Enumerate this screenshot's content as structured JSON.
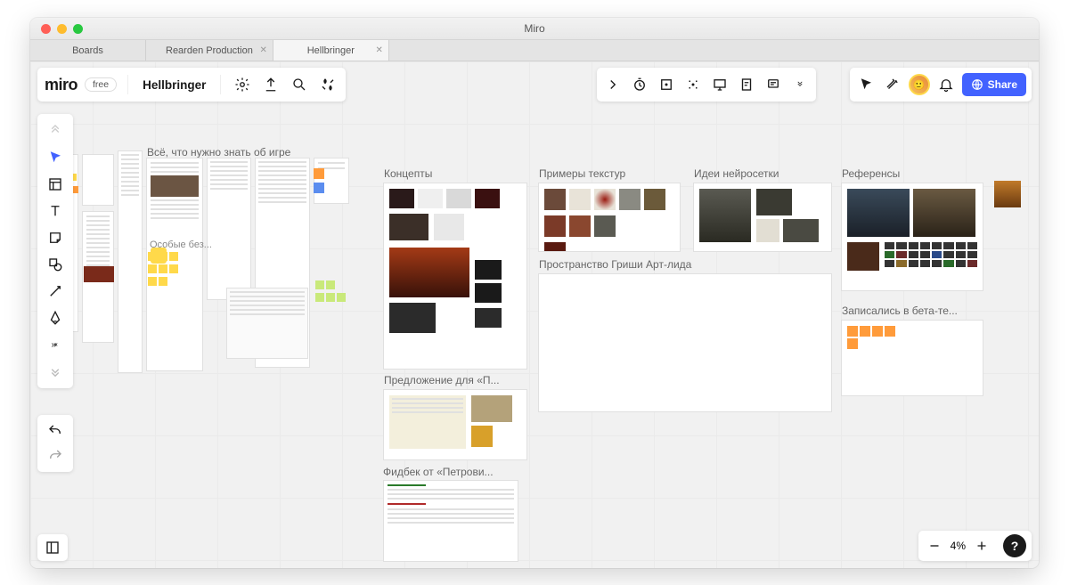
{
  "window": {
    "title": "Miro"
  },
  "tabs": [
    {
      "label": "Boards",
      "closable": false,
      "active": false
    },
    {
      "label": "Rearden Production",
      "closable": true,
      "active": false
    },
    {
      "label": "Hellbringer",
      "closable": true,
      "active": true
    }
  ],
  "header": {
    "logo": "miro",
    "plan_badge": "free",
    "board_name": "Hellbringer"
  },
  "header_tools": [
    "settings",
    "export",
    "search",
    "apps"
  ],
  "topcenter_tools": [
    "collapse",
    "timer",
    "screenshot",
    "focus",
    "present",
    "note",
    "comments",
    "more"
  ],
  "topright": {
    "tools": [
      "cursor-mode",
      "reactions"
    ],
    "share_label": "Share"
  },
  "side_tools": [
    "expand-up",
    "select",
    "template",
    "text",
    "sticky",
    "shape",
    "line",
    "pen",
    "more-h",
    "more-v"
  ],
  "history_tools": [
    "undo",
    "redo"
  ],
  "zoom": {
    "level": "4%"
  },
  "frames": {
    "about": "Всё, что нужно знать об игре",
    "osobye": "Особые без...",
    "concepts": "Концепты",
    "textures": "Примеры текстур",
    "neural": "Идеи нейросетки",
    "refs": "Референсы",
    "artlead": "Пространство Гриши Арт-лида",
    "beta": "Записались в бета-те...",
    "proposal": "Предложение для «П...",
    "feedback": "Фидбек от «Петрови..."
  }
}
